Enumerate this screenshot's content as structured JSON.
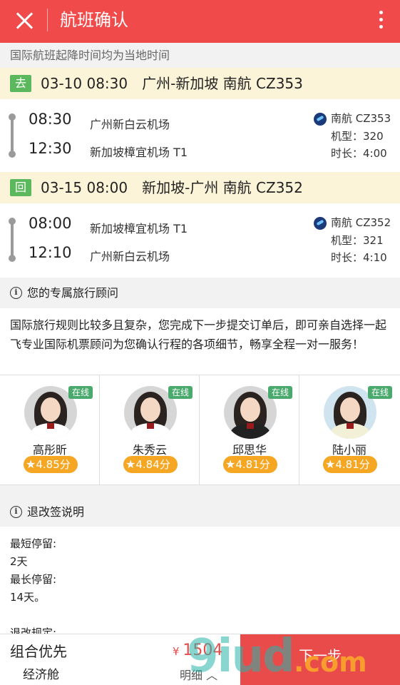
{
  "header": {
    "title": "航班确认"
  },
  "notice": "国际航班起降时间均为当地时间",
  "outbound": {
    "tag": "去",
    "summary": "03-10 08:30　广州-新加坡 南航 CZ353",
    "depart_time": "08:30",
    "depart_airport": "广州新白云机场",
    "arrive_time": "12:30",
    "arrive_airport": "新加坡樟宜机场 T1",
    "airline": "南航 CZ353",
    "aircraft": "机型：320",
    "duration": "时长：4:00"
  },
  "return": {
    "tag": "回",
    "summary": "03-15 08:00　新加坡-广州 南航 CZ352",
    "depart_time": "08:00",
    "depart_airport": "新加坡樟宜机场 T1",
    "arrive_time": "12:10",
    "arrive_airport": "广州新白云机场",
    "airline": "南航 CZ352",
    "aircraft": "机型：321",
    "duration": "时长：4:10"
  },
  "advisor_section": {
    "title": "您的专属旅行顾问",
    "description": "国际旅行规则比较多且复杂，您完成下一步提交订单后，即可亲自选择一起飞专业国际机票顾问为您确认行程的各项细节，畅享全程一对一服务！",
    "online_label": "在线",
    "advisors": [
      {
        "name": "高彤昕",
        "rating": "4.85分"
      },
      {
        "name": "朱秀云",
        "rating": "4.84分"
      },
      {
        "name": "邱思华",
        "rating": "4.81分"
      },
      {
        "name": "陆小丽",
        "rating": "4.81分"
      }
    ]
  },
  "refund_section": {
    "title": "退改签说明",
    "lines": [
      "最短停留:",
      "2天",
      "最长停留:",
      "14天。",
      "",
      "退改规定:"
    ]
  },
  "bottom": {
    "title": "组合优先",
    "cabin": "经济舱",
    "currency": "¥",
    "price": "1504",
    "detail": "明细 ︿",
    "next_label": "下一步"
  },
  "watermark": {
    "main": "9iud",
    "suffix": ".com"
  }
}
